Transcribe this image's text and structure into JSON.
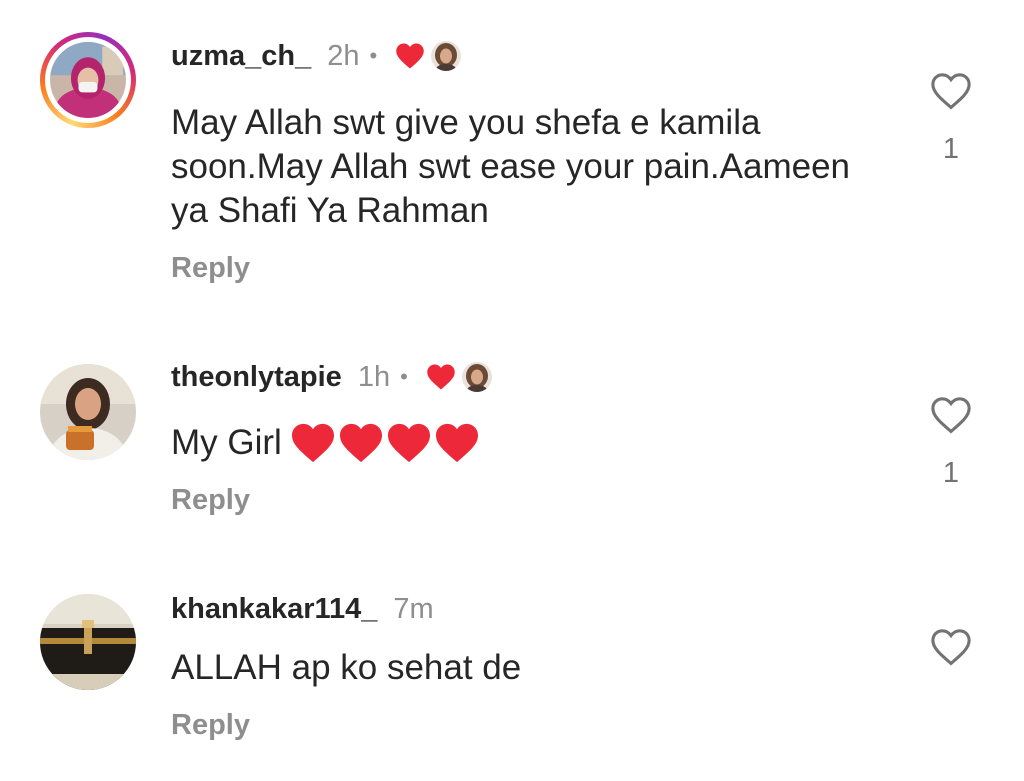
{
  "colors": {
    "text": "#262626",
    "muted": "#8e8e8e",
    "heart_red": "#ed2939"
  },
  "comments": [
    {
      "username": "uzma_ch_",
      "time": "2h",
      "dot": "•",
      "text": "May Allah swt give you shefa e kamila soon.May Allah swt ease your pain.Aameen ya Shafi Ya Rahman",
      "reply_label": "Reply",
      "like_count": "1",
      "has_story_ring": true,
      "liked_by_creator": true
    },
    {
      "username": "theonlytapie",
      "time": "1h",
      "dot": "•",
      "text": "My Girl",
      "reply_label": "Reply",
      "like_count": "1",
      "has_story_ring": false,
      "liked_by_creator": true,
      "emoji": "red-heart x4"
    },
    {
      "username": "khankakar114_",
      "time": "7m",
      "text": "ALLAH ap ko sehat de",
      "reply_label": "Reply",
      "like_count": "",
      "has_story_ring": false,
      "liked_by_creator": false
    }
  ]
}
